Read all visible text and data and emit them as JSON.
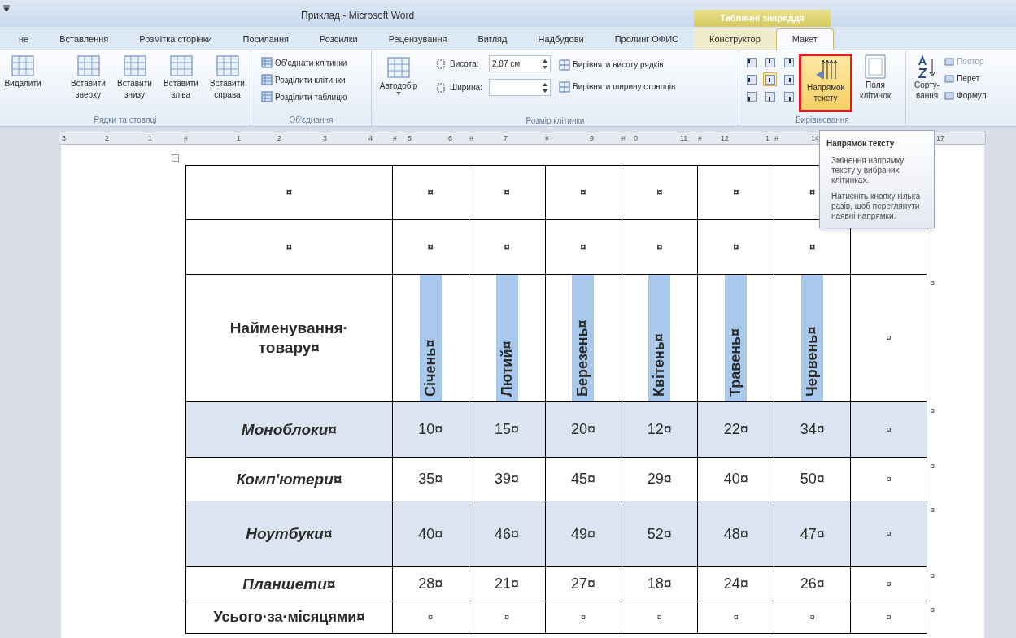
{
  "window": {
    "title": "Приклад - Microsoft Word",
    "context_title": "Табличні знаряддя"
  },
  "tabs": [
    {
      "label": "не",
      "selected": false
    },
    {
      "label": "Вставлення",
      "selected": false
    },
    {
      "label": "Розмітка сторінки",
      "selected": false
    },
    {
      "label": "Посилання",
      "selected": false
    },
    {
      "label": "Розсилки",
      "selected": false
    },
    {
      "label": "Рецензування",
      "selected": false
    },
    {
      "label": "Вигляд",
      "selected": false
    },
    {
      "label": "Надбудови",
      "selected": false
    },
    {
      "label": "Пролинг ОФИС",
      "selected": false
    },
    {
      "label": "Конструктор",
      "selected": false
    },
    {
      "label": "Макет",
      "selected": true
    }
  ],
  "ribbon": {
    "rows_columns": {
      "label": "Рядки та стовпці",
      "buttons": [
        [
          "Видалити"
        ],
        [
          "Вставити",
          "зверху"
        ],
        [
          "Вставити",
          "знизу"
        ],
        [
          "Вставити",
          "зліва"
        ],
        [
          "Вставити",
          "справа"
        ]
      ]
    },
    "merge": {
      "label": "Об'єднання",
      "buttons": [
        "Об'єднати клітинки",
        "Розділити клітинки",
        "Розділити таблицю"
      ]
    },
    "cell_size": {
      "label": "Розмір клітинки",
      "autofit": "Автодобір",
      "height_label": "Висота:",
      "height_value": "2,87 см",
      "width_label": "Ширина:",
      "distribute": [
        "Вирівняти висоту рядків",
        "Вирівняти ширину стовпців"
      ]
    },
    "alignment": {
      "label": "Вирівнювання",
      "cells": [
        {
          "selected": false
        },
        {
          "selected": false
        },
        {
          "selected": false
        },
        {
          "selected": false
        },
        {
          "selected": true
        },
        {
          "selected": false
        },
        {
          "selected": false
        },
        {
          "selected": false
        },
        {
          "selected": false
        }
      ],
      "direction": [
        "Напрямок",
        "тексту"
      ],
      "margins": [
        "Поля",
        "клітинок"
      ]
    },
    "data": {
      "sort": [
        "Сорту-",
        "вання"
      ],
      "items": [
        "Повтор",
        "Перет",
        "Формул"
      ]
    }
  },
  "ruler": [
    "3",
    "2",
    "1",
    "#",
    "1",
    "2",
    "3",
    "4",
    "#",
    "5",
    "6",
    "#",
    "7",
    "#",
    "9",
    "#",
    "0",
    "11",
    "#",
    "12",
    "1",
    "#",
    "14",
    "17"
  ],
  "table": {
    "rows": [
      {
        "kind": "empty",
        "shaded": false,
        "cells": [
          "¤",
          "¤",
          "¤",
          "¤",
          "¤",
          "¤",
          "¤"
        ]
      },
      {
        "kind": "empty",
        "shaded": false,
        "cells": [
          "¤",
          "¤",
          "¤",
          "¤",
          "¤",
          "¤",
          "¤"
        ]
      },
      {
        "kind": "header",
        "shaded": false,
        "end_mark": "¤",
        "cells": [
          "Найменування·товару¤",
          "Січень¤",
          "Лютий¤",
          "Березень¤",
          "Квітень¤",
          "Травень¤",
          "Червень¤",
          "¤"
        ]
      },
      {
        "kind": "product",
        "shaded": true,
        "end_mark": "¤",
        "cells": [
          "Моноблоки¤",
          "10¤",
          "15¤",
          "20¤",
          "12¤",
          "22¤",
          "34¤",
          "¤"
        ]
      },
      {
        "kind": "product",
        "shaded": false,
        "end_mark": "¤",
        "cells": [
          "Комп'ютери¤",
          "35¤",
          "39¤",
          "45¤",
          "29¤",
          "40¤",
          "50¤",
          "¤"
        ]
      },
      {
        "kind": "product",
        "shaded": true,
        "end_mark": "¤",
        "cells": [
          "Ноутбуки¤",
          "40¤",
          "46¤",
          "49¤",
          "52¤",
          "48¤",
          "47¤",
          "¤"
        ]
      },
      {
        "kind": "product",
        "shaded": false,
        "end_mark": "¤",
        "cells": [
          "Планшети¤",
          "28¤",
          "21¤",
          "27¤",
          "18¤",
          "24¤",
          "26¤",
          "¤"
        ]
      },
      {
        "kind": "total",
        "shaded": false,
        "end_mark": "¤",
        "cells": [
          "Усього·за·місяцями¤",
          "¤",
          "¤",
          "¤",
          "¤",
          "¤",
          "¤",
          "¤"
        ]
      }
    ]
  },
  "tooltip": {
    "title": "Напрямок тексту",
    "description": "Змінення напрямку тексту у вибраних клітинках.",
    "hint": "Натисніть кнопку кілька разів, щоб переглянути наявні напрямки."
  }
}
